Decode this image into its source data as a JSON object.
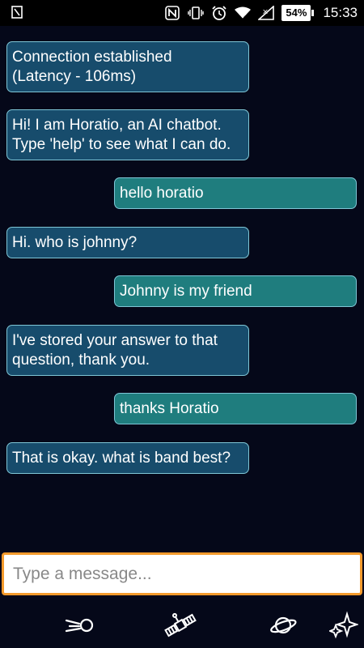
{
  "status_bar": {
    "battery": "54%",
    "time": "15:33"
  },
  "messages": [
    {
      "sender": "bot",
      "text": "Connection established\n(Latency - 106ms)"
    },
    {
      "sender": "bot",
      "text": "Hi! I am Horatio, an AI chatbot.\nType 'help' to see what I can do."
    },
    {
      "sender": "user",
      "text": "hello horatio"
    },
    {
      "sender": "bot",
      "text": "Hi. who is johnny?"
    },
    {
      "sender": "user",
      "text": "Johnny is my friend"
    },
    {
      "sender": "bot",
      "text": "I've stored your answer to that\nquestion, thank you."
    },
    {
      "sender": "user",
      "text": "thanks Horatio"
    },
    {
      "sender": "bot",
      "text": "That is okay. what is band best?"
    }
  ],
  "composer": {
    "placeholder": "Type a message...",
    "value": ""
  },
  "colors": {
    "background": "#050819",
    "bot_bubble": "#174c6c",
    "user_bubble": "#1f7d7e",
    "bubble_border": "#7fc6d6",
    "input_border": "#f49a2c"
  },
  "nav_icons": [
    "comet-icon",
    "satellite-icon",
    "planet-icon",
    "sparkles-icon"
  ]
}
